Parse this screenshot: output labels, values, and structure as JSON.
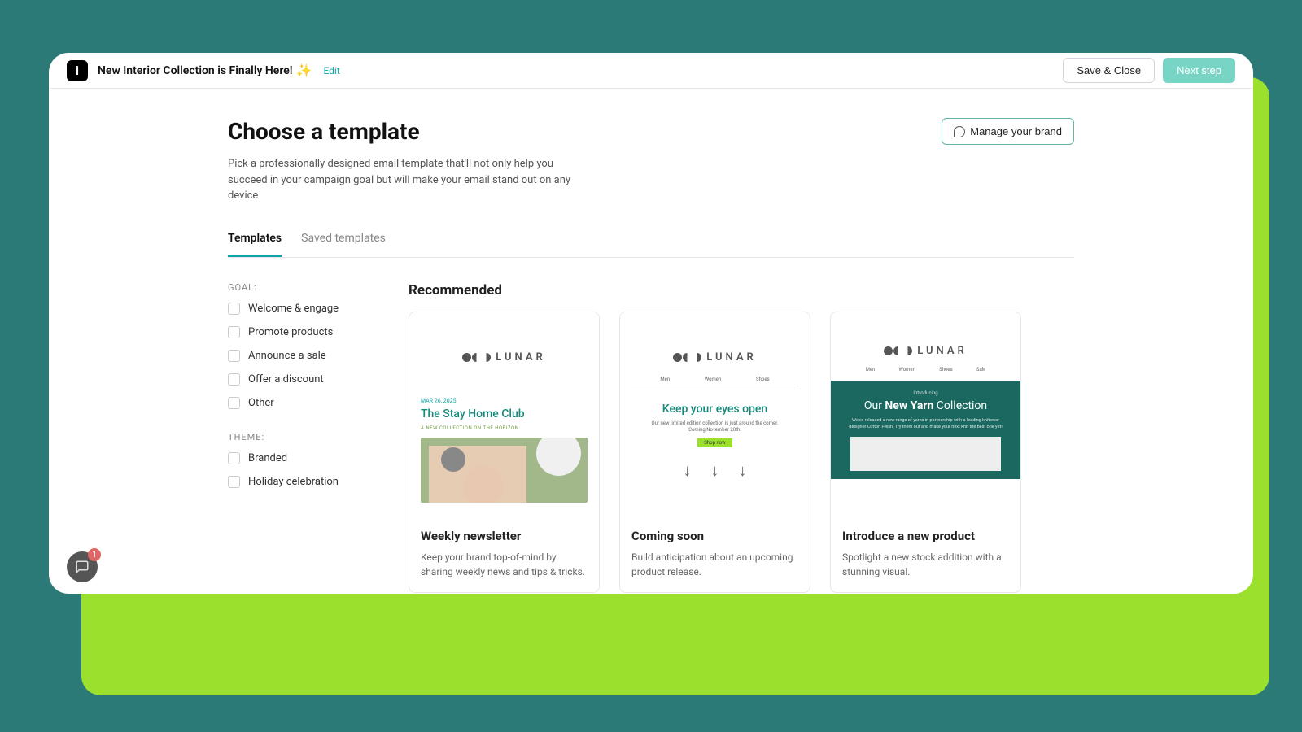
{
  "header": {
    "campaign_title": "New Interior Collection is Finally Here!",
    "sparkle": "✨",
    "edit_label": "Edit",
    "save_close_label": "Save & Close",
    "next_step_label": "Next step"
  },
  "page": {
    "title": "Choose a template",
    "subtitle": "Pick a professionally designed email template that'll not only help you succeed in your campaign goal but will make your email stand out on any device",
    "manage_brand_label": "Manage your brand"
  },
  "tabs": [
    {
      "label": "Templates",
      "active": true
    },
    {
      "label": "Saved templates",
      "active": false
    }
  ],
  "filters": {
    "goal_heading": "GOAL:",
    "goal_items": [
      "Welcome & engage",
      "Promote products",
      "Announce a sale",
      "Offer a discount",
      "Other"
    ],
    "theme_heading": "THEME:",
    "theme_items": [
      "Branded",
      "Holiday celebration"
    ]
  },
  "section_title": "Recommended",
  "cards": [
    {
      "title": "Weekly newsletter",
      "desc": "Keep your brand top-of-mind by sharing weekly news and tips & tricks.",
      "preview": {
        "brand": "LUNAR",
        "date": "MAR 26, 2025",
        "headline": "The Stay Home Club",
        "subline": "A NEW COLLECTION ON THE HORIZON"
      }
    },
    {
      "title": "Coming soon",
      "desc": "Build anticipation about an upcoming product release.",
      "preview": {
        "brand": "LUNAR",
        "nav": [
          "Men",
          "Women",
          "Shoes"
        ],
        "headline": "Keep your eyes open",
        "subline": "Our new limited edition collection is just around the corner. Coming November 20th.",
        "cta": "Shop now"
      }
    },
    {
      "title": "Introduce a new product",
      "desc": "Spotlight a new stock addition with a stunning visual.",
      "preview": {
        "brand": "LUNAR",
        "nav": [
          "Men",
          "Women",
          "Shoes",
          "Sale"
        ],
        "intro": "Introducing",
        "headline_pre": "Our ",
        "headline_strong": "New Yarn",
        "headline_post": " Collection",
        "subline": "We've released a new range of yarns in partnership with a leading knitwear designer Cotton Fresh. Try them out and make your next knit the best one yet!"
      }
    }
  ],
  "chat": {
    "badge": "1"
  }
}
